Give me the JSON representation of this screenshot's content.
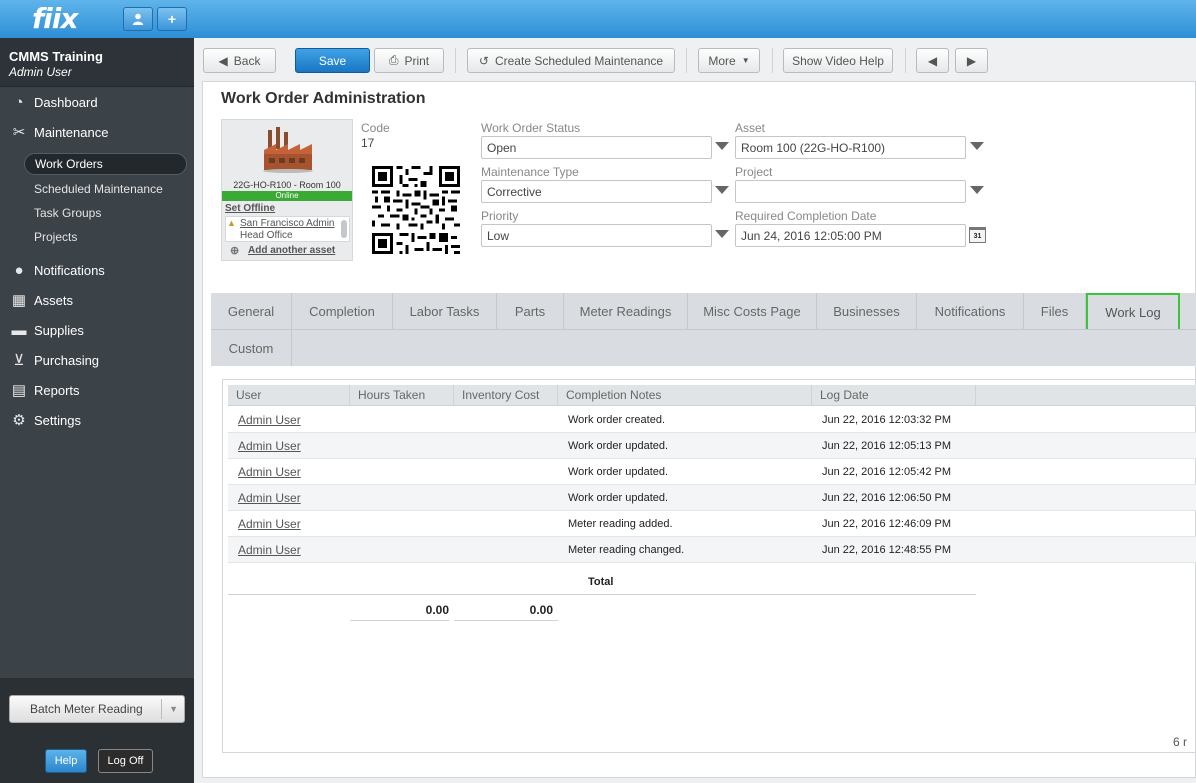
{
  "app": {
    "logo": "fiix"
  },
  "topbar": {
    "user_icon": "user-icon",
    "add_icon": "plus-icon"
  },
  "sidebar": {
    "org": "CMMS Training",
    "user": "Admin User",
    "items": [
      {
        "label": "Dashboard",
        "icon": "dashboard-icon"
      },
      {
        "label": "Maintenance",
        "icon": "tools-icon"
      },
      {
        "label": "Notifications",
        "icon": "chat-icon"
      },
      {
        "label": "Assets",
        "icon": "boxes-icon"
      },
      {
        "label": "Supplies",
        "icon": "truck-icon"
      },
      {
        "label": "Purchasing",
        "icon": "cart-icon"
      },
      {
        "label": "Reports",
        "icon": "chart-icon"
      },
      {
        "label": "Settings",
        "icon": "gear-icon"
      }
    ],
    "sub_items": [
      "Work Orders",
      "Scheduled Maintenance",
      "Task Groups",
      "Projects"
    ],
    "active_sub": "Work Orders",
    "batch_label": "Batch Meter Reading",
    "help_label": "Help",
    "logoff_label": "Log Off"
  },
  "toolbar": {
    "back": "Back",
    "save": "Save",
    "print": "Print",
    "create_sm": "Create Scheduled Maintenance",
    "more": "More",
    "video_help": "Show Video Help"
  },
  "page": {
    "title": "Work Order Administration",
    "asset_card": {
      "name": "22G-HO-R100 - Room 100",
      "status": "Online",
      "set_offline": "Set Offline",
      "location1": "San Francisco Admin",
      "location2": "Head Office",
      "add_another": "Add another asset"
    },
    "code_label": "Code",
    "code_value": "17",
    "fields": {
      "status_label": "Work Order Status",
      "status_value": "Open",
      "type_label": "Maintenance Type",
      "type_value": "Corrective",
      "priority_label": "Priority",
      "priority_value": "Low",
      "asset_label": "Asset",
      "asset_value": "Room 100 (22G-HO-R100)",
      "project_label": "Project",
      "project_value": "",
      "rcd_label": "Required Completion Date",
      "rcd_value": "Jun 24, 2016 12:05:00 PM",
      "cal_text": "31"
    }
  },
  "tabs": {
    "row1": [
      "General",
      "Completion",
      "Labor Tasks",
      "Parts",
      "Meter Readings",
      "Misc Costs Page",
      "Businesses",
      "Notifications",
      "Files",
      "Work Log"
    ],
    "row2": [
      "Custom"
    ],
    "active": "Work Log"
  },
  "grid": {
    "columns": [
      "User",
      "Hours Taken",
      "Inventory Cost",
      "Completion Notes",
      "Log Date"
    ],
    "rows": [
      {
        "user": "Admin User",
        "notes": "Work order created.",
        "date": "Jun 22, 2016 12:03:32 PM"
      },
      {
        "user": "Admin User",
        "notes": "Work order updated.",
        "date": "Jun 22, 2016 12:05:13 PM"
      },
      {
        "user": "Admin User",
        "notes": "Work order updated.",
        "date": "Jun 22, 2016 12:05:42 PM"
      },
      {
        "user": "Admin User",
        "notes": "Work order updated.",
        "date": "Jun 22, 2016 12:06:50 PM"
      },
      {
        "user": "Admin User",
        "notes": "Meter reading added.",
        "date": "Jun 22, 2016 12:46:09 PM"
      },
      {
        "user": "Admin User",
        "notes": "Meter reading changed.",
        "date": "Jun 22, 2016 12:48:55 PM"
      }
    ],
    "total_label": "Total",
    "total_hours": "0.00",
    "total_cost": "0.00",
    "count_text": "6 r"
  }
}
